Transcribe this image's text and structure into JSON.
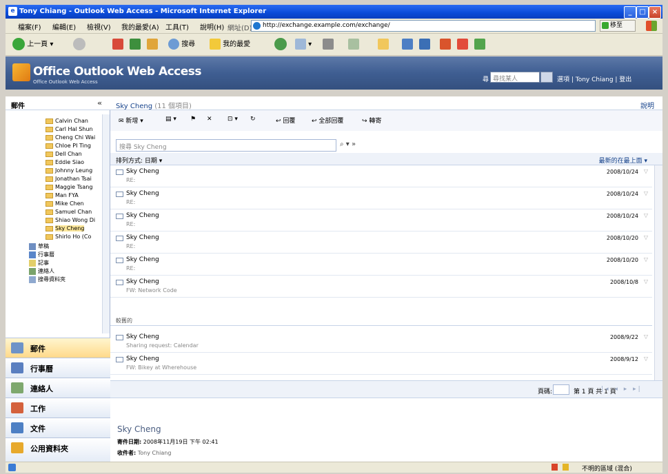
{
  "window": {
    "title": "Tony Chiang - Outlook Web Access - Microsoft Internet Explorer",
    "controls": [
      "_",
      "□",
      "×"
    ]
  },
  "menubar": {
    "items": [
      "檔案(F)",
      "編輯(E)",
      "檢視(V)",
      "我的最愛(A)",
      "工具(T)",
      "說明(H)"
    ],
    "address_label": "網址(D)",
    "address": "http://exchange.example.com/exchange/",
    "go": "移至"
  },
  "ietoolbar": {
    "back": "上一頁",
    "search": "搜尋",
    "favorites": "我的最愛"
  },
  "owa": {
    "logo": "Office Outlook Web Access",
    "sub": "Office Outlook Web Access",
    "find_label": "尋",
    "find_placeholder": "尋找某人",
    "links": "選項 | Tony Chiang | 登出"
  },
  "folders": {
    "header": "郵件",
    "collapse": "«",
    "items": [
      "Calvin Chan",
      "Carl Hal Shun",
      "Cheng Chi Wai",
      "Chloe PI Ting",
      "Dell Chan",
      "Eddie Siao",
      "Johnny Leung",
      "Jonathan Tsai",
      "Maggie Tsang",
      "Man FYA",
      "Mike Chen",
      "Samuel Chan",
      "Shiao Wong Di",
      "Sky Cheng",
      "Shirlo Ho (Co"
    ],
    "system": [
      "草稿",
      "行事曆",
      "記事",
      "連絡人",
      "搜尋資料夾"
    ]
  },
  "nav": [
    "郵件",
    "行事曆",
    "連絡人",
    "工作",
    "文件",
    "公用資料夾"
  ],
  "main": {
    "title": "Sky Cheng",
    "title_count": "(11 個項目)",
    "help": "說明",
    "toolbar": [
      "新增",
      "回覆",
      "全部回覆",
      "轉寄"
    ],
    "search_placeholder": "搜尋 Sky Cheng",
    "arrange": "排列方式: 日期 ▾",
    "arrange_right": "最新的在最上面 ▾",
    "messages": [
      {
        "from": "Sky Cheng",
        "subject": "RE:",
        "date": "2008/10/24"
      },
      {
        "from": "Sky Cheng",
        "subject": "RE:",
        "date": "2008/10/24"
      },
      {
        "from": "Sky Cheng",
        "subject": "RE:",
        "date": "2008/10/24"
      },
      {
        "from": "Sky Cheng",
        "subject": "RE:",
        "date": "2008/10/20"
      },
      {
        "from": "Sky Cheng",
        "subject": "RE:",
        "date": "2008/10/20"
      },
      {
        "from": "Sky Cheng",
        "subject": "FW: Network Code",
        "date": "2008/10/8"
      }
    ],
    "group2": "較舊的",
    "messages2": [
      {
        "from": "Sky Cheng",
        "subject": "Sharing request: Calendar",
        "date": "2008/9/22"
      },
      {
        "from": "Sky Cheng",
        "subject": "FW: Bikey at Wherehouse",
        "date": "2008/9/12"
      }
    ],
    "page_label": "頁碼:",
    "page_of": "第 1 頁 共 1 頁",
    "page_nav": "|◂ ◂ ▸ ▸|"
  },
  "preview": {
    "from": "Sky Cheng",
    "sent_label": "寄件日期:",
    "sent_value": "2008年11月19日 下午 02:41",
    "to_label": "收件者:",
    "to_value": "Tony Chiang"
  },
  "status": {
    "zone": "不明的區域 (混合)"
  }
}
